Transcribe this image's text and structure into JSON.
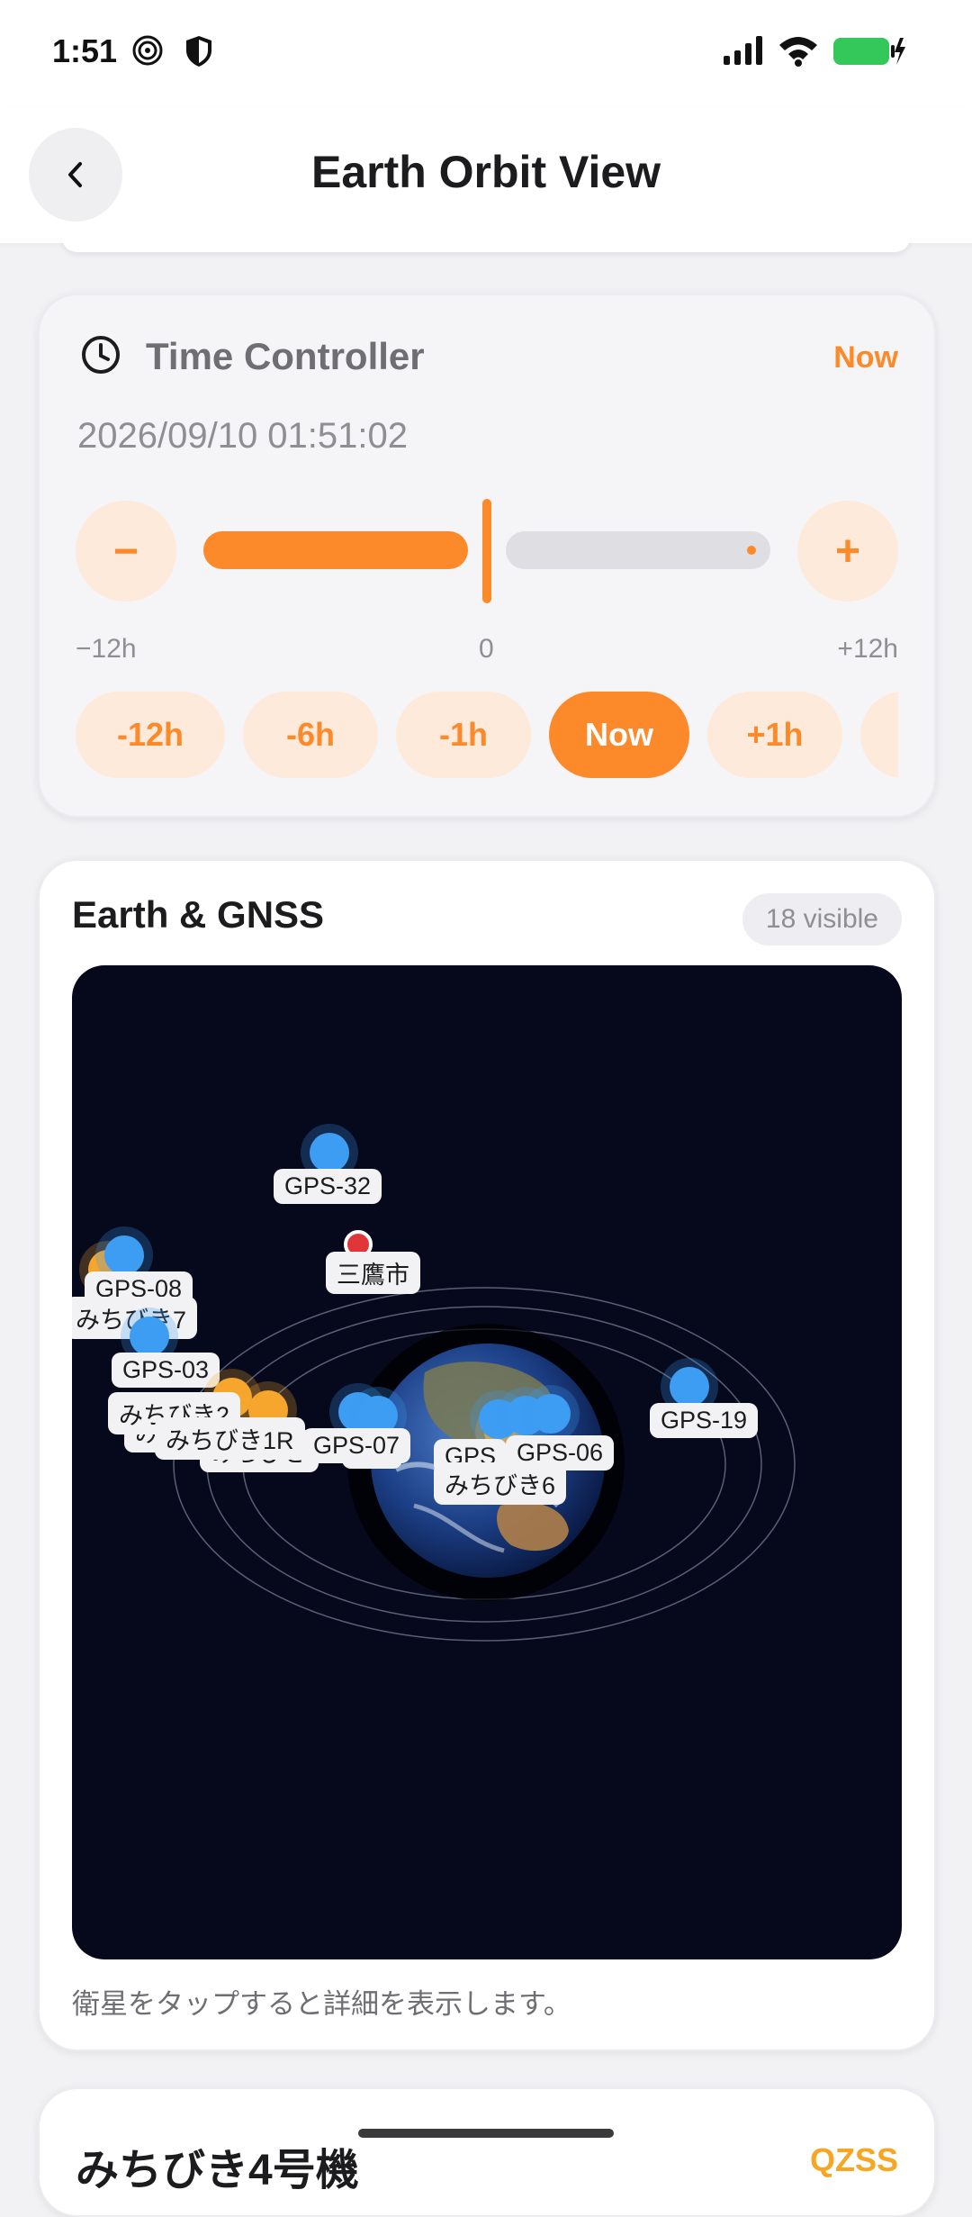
{
  "status_bar": {
    "time": "1:51"
  },
  "header": {
    "title": "Earth Orbit View"
  },
  "time_controller": {
    "title": "Time Controller",
    "now_link": "Now",
    "datetime": "2026/09/10 01:51:02",
    "minus_label": "−",
    "plus_label": "+",
    "tick_left": "−12h",
    "tick_mid": "0",
    "tick_right": "+12h",
    "slider_value_hours": 0,
    "chips": [
      "-12h",
      "-6h",
      "-1h",
      "Now",
      "+1h"
    ],
    "active_chip": "Now"
  },
  "earth_card": {
    "title": "Earth & GNSS",
    "visible_badge": "18 visible",
    "location_label": "三鷹市",
    "hint": "衛星をタップすると詳細を表示します。",
    "satellites": {
      "gps32": "GPS-32",
      "gps08": "GPS-08",
      "michibiki7": "みちびき7",
      "gps03": "GPS-03",
      "michibiki2": "みちびき2",
      "michibiki_overlap": "み",
      "michibiki1r": "みちびき1R",
      "michibiki_partial": "みちびき",
      "gps07": "GPS-07",
      "gps_4": "4",
      "gps_partial": "GPS",
      "gps06": "GPS-06",
      "michibiki6": "みちびき6",
      "gps19": "GPS-19"
    }
  },
  "next_card": {
    "title": "みちびき4号機",
    "badge": "QZSS"
  },
  "colors": {
    "accent": "#fd8a2a",
    "gps": "#3d9df3",
    "qzss": "#f6a62c",
    "space": "#06091c"
  },
  "icons": [
    "back-chevron-icon",
    "clock-icon",
    "signal-icon",
    "wifi-icon",
    "battery-icon",
    "location-pin-icon"
  ]
}
